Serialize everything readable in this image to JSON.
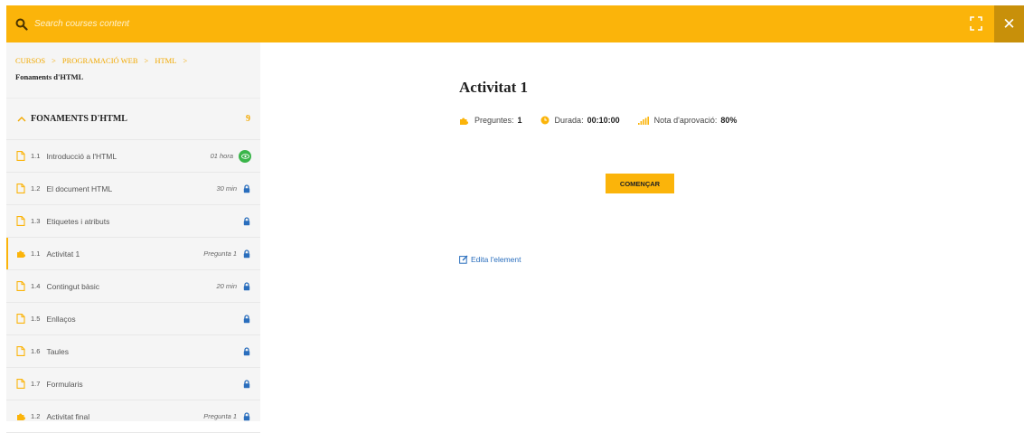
{
  "search": {
    "placeholder": "Search courses content"
  },
  "breadcrumb": {
    "items": [
      "Cursos",
      "Programació Web",
      "HTML"
    ],
    "separator": ">",
    "current": "Fonaments d'HTML"
  },
  "section": {
    "title": "Fonaments d'HTML",
    "count": "9"
  },
  "lessons": [
    {
      "num": "1.1",
      "title": "Introducció a l'HTML",
      "meta": "01 hora",
      "status": "preview",
      "type": "page"
    },
    {
      "num": "1.2",
      "title": "El document HTML",
      "meta": "30 min",
      "status": "locked",
      "type": "page"
    },
    {
      "num": "1.3",
      "title": "Etiquetes i atributs",
      "meta": "",
      "status": "locked",
      "type": "page"
    },
    {
      "num": "1.1",
      "title": "Activitat 1",
      "meta": "Pregunta 1",
      "status": "locked",
      "type": "quiz",
      "active": true
    },
    {
      "num": "1.4",
      "title": "Contingut bàsic",
      "meta": "20 min",
      "status": "locked",
      "type": "page"
    },
    {
      "num": "1.5",
      "title": "Enllaços",
      "meta": "",
      "status": "locked",
      "type": "page"
    },
    {
      "num": "1.6",
      "title": "Taules",
      "meta": "",
      "status": "locked",
      "type": "page"
    },
    {
      "num": "1.7",
      "title": "Formularis",
      "meta": "",
      "status": "locked",
      "type": "page"
    },
    {
      "num": "1.2",
      "title": "Activitat final",
      "meta": "Pregunta 1",
      "status": "locked",
      "type": "quiz"
    }
  ],
  "main": {
    "title": "Activitat 1",
    "questions_label": "Preguntes:",
    "questions_value": "1",
    "duration_label": "Durada:",
    "duration_value": "00:10:00",
    "pass_label": "Nota d'aprovació:",
    "pass_value": "80%",
    "start_label": "Començar",
    "edit_label": "Edita l'element"
  },
  "colors": {
    "accent": "#fbb40a",
    "accent_dark": "#c8900a",
    "link": "#2a6ebd",
    "preview": "#3ab54a"
  }
}
